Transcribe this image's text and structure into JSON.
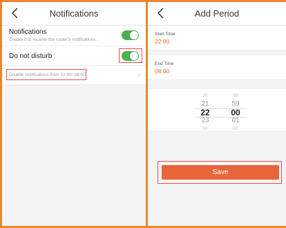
{
  "left": {
    "title": "Notifications",
    "notifications": {
      "label": "Notifications",
      "sublabel": "Enable it to receive the router's notifications.",
      "enabled": true
    },
    "dnd": {
      "label": "Do not disturb",
      "enabled": true
    },
    "schedule": {
      "text": "Disable notifications from 22:00~08:00",
      "chevron": "chevron-right-icon"
    }
  },
  "right": {
    "title": "Add Period",
    "start": {
      "label": "Start Time",
      "value": "22:00"
    },
    "end": {
      "label": "End Time",
      "value": "08:00"
    },
    "picker": {
      "hours": [
        "20",
        "21",
        "22",
        "23",
        "00"
      ],
      "minutes": [
        "58",
        "59",
        "00",
        "01",
        "02"
      ]
    },
    "save_label": "Save"
  },
  "colors": {
    "accent": "#e8653a",
    "toggle_on": "#4caf50",
    "highlight_box": "#e74c4c",
    "panel_border": "#e8872b"
  }
}
